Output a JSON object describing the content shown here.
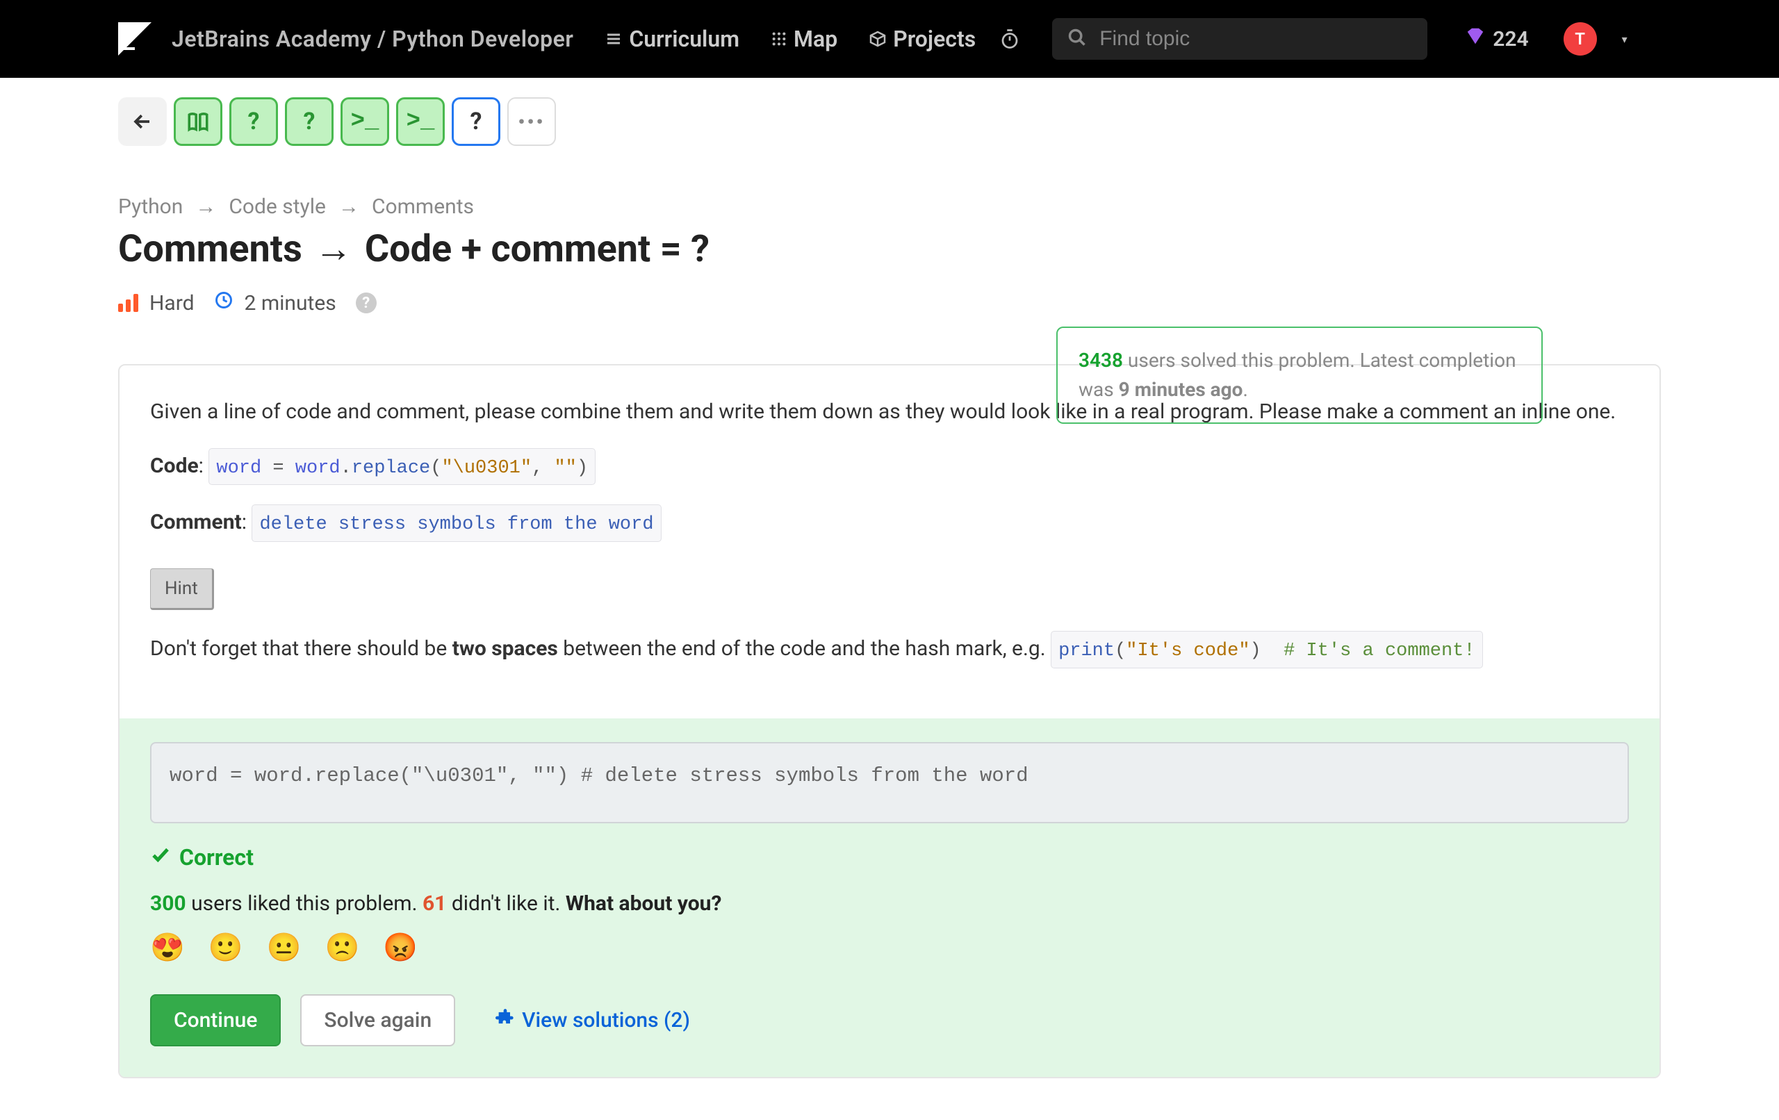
{
  "header": {
    "brand": "JetBrains Academy / Python Developer",
    "nav": {
      "curriculum": "Curriculum",
      "map": "Map",
      "projects": "Projects"
    },
    "search_placeholder": "Find topic",
    "gems": "224",
    "avatar_initial": "T"
  },
  "breadcrumb": {
    "a": "Python",
    "b": "Code style",
    "c": "Comments"
  },
  "title": {
    "left": "Comments",
    "right": "Code + comment = ?"
  },
  "meta": {
    "difficulty": "Hard",
    "time": "2 minutes"
  },
  "stats": {
    "solved_count": "3438",
    "solved_suffix": " users solved this problem. Latest completion was ",
    "ago": "9 minutes ago"
  },
  "prompt": {
    "intro": "Given a line of code and comment, please combine them and write them down as they would look like in a real program. Please make a comment an inline one.",
    "code_label": "Code",
    "code_value": "word = word.replace(\"\\u0301\", \"\")",
    "comment_label": "Comment",
    "comment_value": "delete stress symbols from the word",
    "hint_btn": "Hint",
    "hint_text_a": "Don't forget that there should be ",
    "hint_text_b": "two spaces",
    "hint_text_c": " between the end of the code and the hash mark, e.g. ",
    "hint_example_code": "print(\"It's code\")",
    "hint_example_cmt": "# It's a comment!"
  },
  "answer": {
    "value": "word = word.replace(\"\\u0301\", \"\")  # delete stress symbols from the word",
    "correct": "Correct"
  },
  "feedback": {
    "likes": "300",
    "likes_suffix": " users liked this problem. ",
    "dislikes": "61",
    "dislikes_suffix": " didn't like it. ",
    "prompt": "What about you?"
  },
  "buttons": {
    "continue": "Continue",
    "solve_again": "Solve again",
    "view_solutions": "View solutions (2)"
  }
}
